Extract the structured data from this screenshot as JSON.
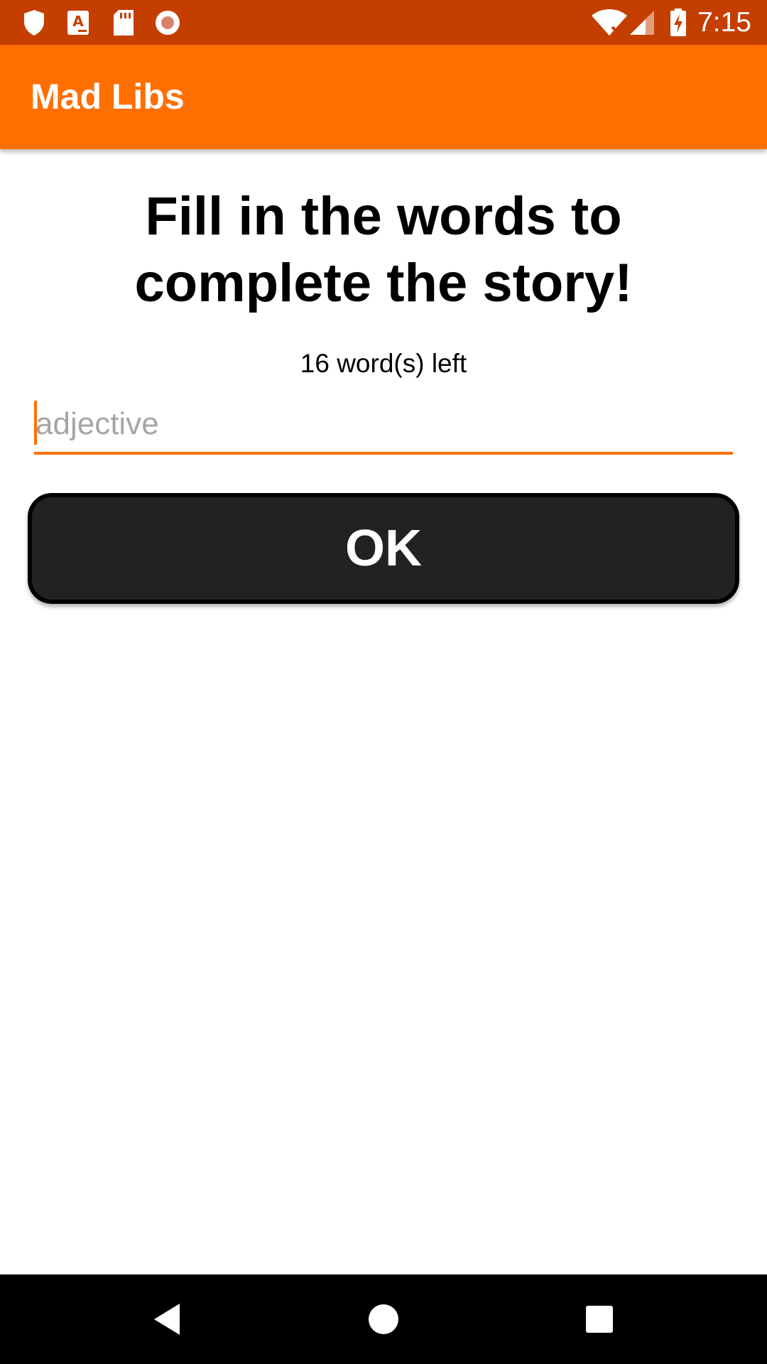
{
  "status_bar": {
    "time": "7:15",
    "icons": [
      "shield-icon",
      "a-app-icon",
      "sd-card-icon",
      "record-icon",
      "wifi-icon",
      "signal-icon",
      "battery-charging-icon"
    ]
  },
  "app_bar": {
    "title": "Mad Libs"
  },
  "main": {
    "heading": "Fill in the words to complete the story!",
    "words_left": "16 word(s) left",
    "input": {
      "value": "",
      "placeholder": "adjective"
    },
    "ok_label": "OK"
  },
  "nav_bar": {
    "icons": [
      "back-icon",
      "home-icon",
      "recents-icon"
    ]
  },
  "colors": {
    "status_bar": "#c43e00",
    "accent": "#ff6f00",
    "button": "#222222"
  }
}
